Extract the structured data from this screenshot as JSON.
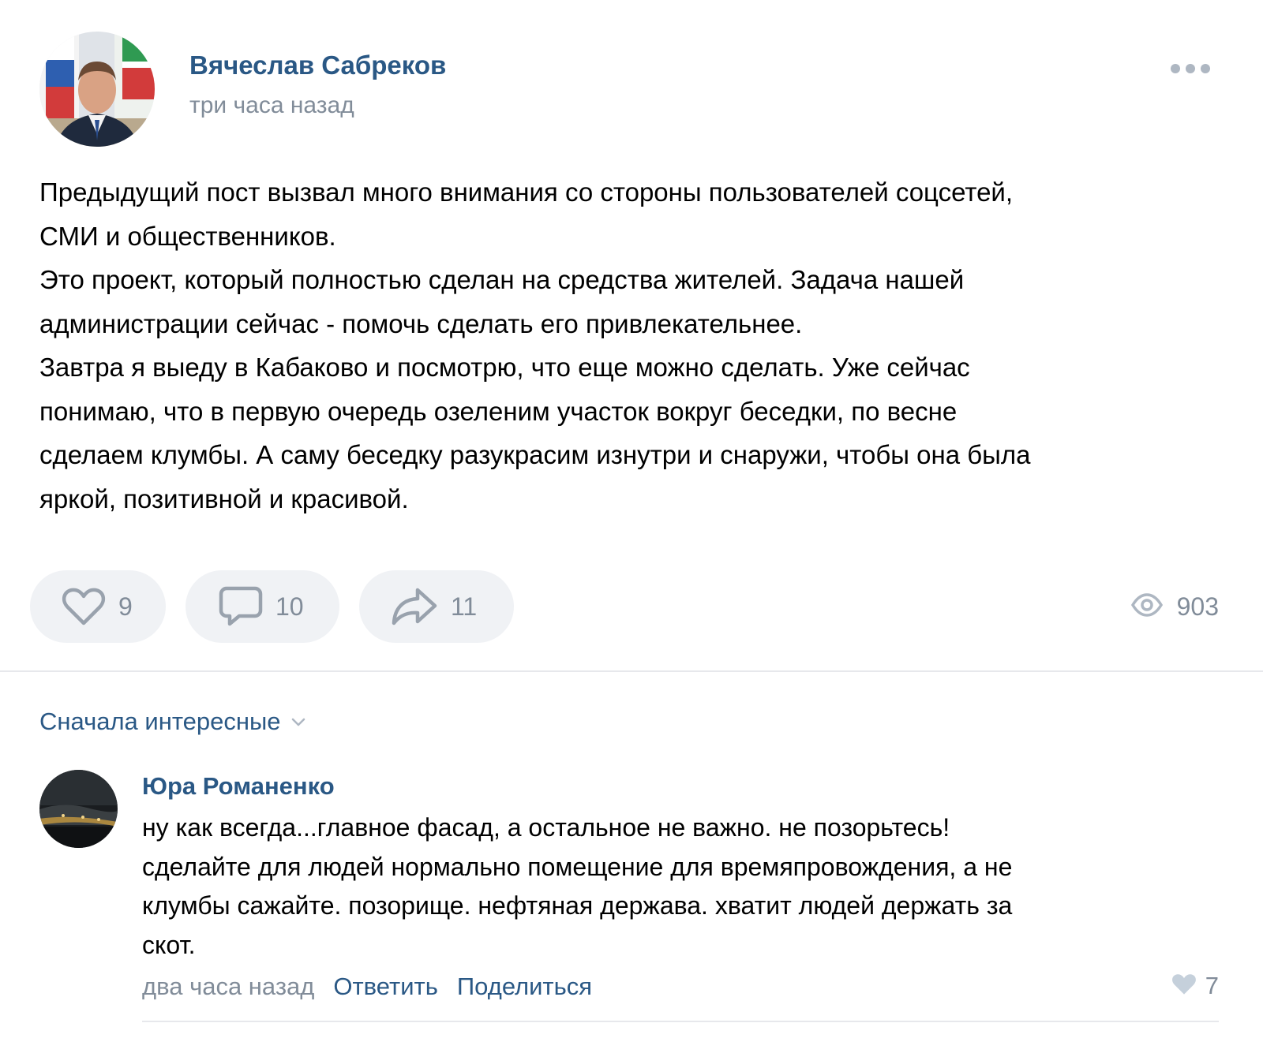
{
  "post": {
    "author": "Вячеслав Сабреков",
    "time": "три часа назад",
    "text_lines": [
      "Предыдущий пост вызвал много внимания со стороны пользователей соцсетей,",
      "СМИ и общественников.",
      "Это проект, который полностью сделан на средства жителей. Задача нашей",
      "администрации сейчас - помочь сделать его привлекательнее.",
      "Завтра я выеду в Кабаково и посмотрю, что еще можно сделать. Уже сейчас",
      "понимаю, что в первую очередь озеленим участок вокруг беседки, по весне",
      "сделаем клумбы. А саму беседку разукрасим изнутри и снаружи, чтобы она была",
      "яркой, позитивной и красивой."
    ],
    "likes": "9",
    "comments": "10",
    "shares": "11",
    "views": "903"
  },
  "sort": {
    "label": "Сначала интересные"
  },
  "comment": {
    "author": "Юра Романенко",
    "text_lines": [
      "ну как всегда...главное фасад, а остальное не важно. не позорьтесь!",
      "сделайте для людей нормально помещение для времяпровождения, а не",
      "клумбы сажайте. позорище. нефтяная держава. хватит людей держать за",
      "скот."
    ],
    "time": "два часа назад",
    "reply_label": "Ответить",
    "share_label": "Поделиться",
    "likes": "7"
  },
  "icons": {
    "more": "more-horizontal-icon",
    "like": "heart-icon",
    "comment": "comment-icon",
    "share": "share-arrow-icon",
    "views": "eye-icon",
    "chevron": "chevron-down-icon",
    "comment_like": "heart-filled-icon"
  },
  "colors": {
    "link": "#2a5885",
    "secondary": "#818c99",
    "button_bg": "#f0f2f5",
    "divider": "#e7e8ec"
  }
}
